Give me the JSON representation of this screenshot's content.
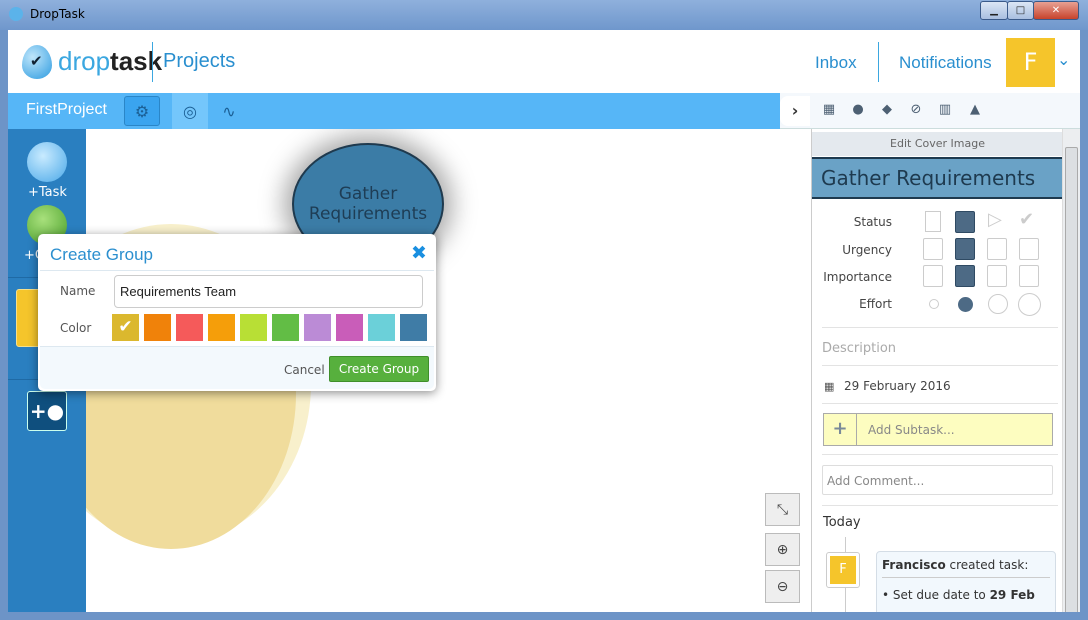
{
  "window": {
    "title": "DropTask",
    "minimize": "▁",
    "maximize": "□",
    "close": "✕"
  },
  "header": {
    "logo_light": "drop",
    "logo_bold": "task",
    "section": "Projects",
    "inbox": "Inbox",
    "notifications": "Notifications",
    "avatar_initial": "F"
  },
  "toolbar": {
    "project_name": "FirstProject",
    "icons": [
      "gear-icon",
      "groups-icon",
      "activity-icon"
    ]
  },
  "panel_toolbar": {
    "icons": [
      "chevron-right-icon",
      "calendar-icon",
      "user-icon",
      "tags-icon",
      "paperclip-icon",
      "trash-icon",
      "bell-icon"
    ]
  },
  "sidebar": {
    "add_task": "+Task",
    "add_group": "+Group"
  },
  "canvas": {
    "task_bubble": "Gather Requirements"
  },
  "dialog": {
    "title": "Create Group",
    "name_label": "Name",
    "name_value": "Requirements Team",
    "color_label": "Color",
    "colors": [
      "#dbb82e",
      "#f0820a",
      "#f55a5a",
      "#f59e0a",
      "#b8df35",
      "#62bd45",
      "#bb8bd6",
      "#c95db9",
      "#6bd0d9",
      "#3f7ca6"
    ],
    "selected_color": "#dbb82e",
    "cancel": "Cancel",
    "create": "Create Group"
  },
  "task": {
    "edit_cover": "Edit Cover Image",
    "title": "Gather Requirements",
    "status_label": "Status",
    "urgency_label": "Urgency",
    "importance_label": "Importance",
    "effort_label": "Effort",
    "status_selected": "stopped",
    "urgency_selected": "normal",
    "importance_selected": "normal",
    "effort_selected": "small",
    "description_placeholder": "Description",
    "due_date": "29 February 2016",
    "subtask_placeholder": "Add Subtask...",
    "comment_placeholder": "Add Comment...",
    "activity_heading": "Today",
    "activity_user": "Francisco",
    "activity_action": " created task:",
    "activity_item_prefix": "• Set due date to ",
    "activity_item_bold": "29 Feb",
    "activity_avatar": "F"
  },
  "colors": {
    "accent": "#56b6f7",
    "sidebar": "#2a7fc0",
    "task_blue": "#3b7ca6",
    "group_yellow": "#f0dc9c",
    "create_green": "#57b03d"
  }
}
